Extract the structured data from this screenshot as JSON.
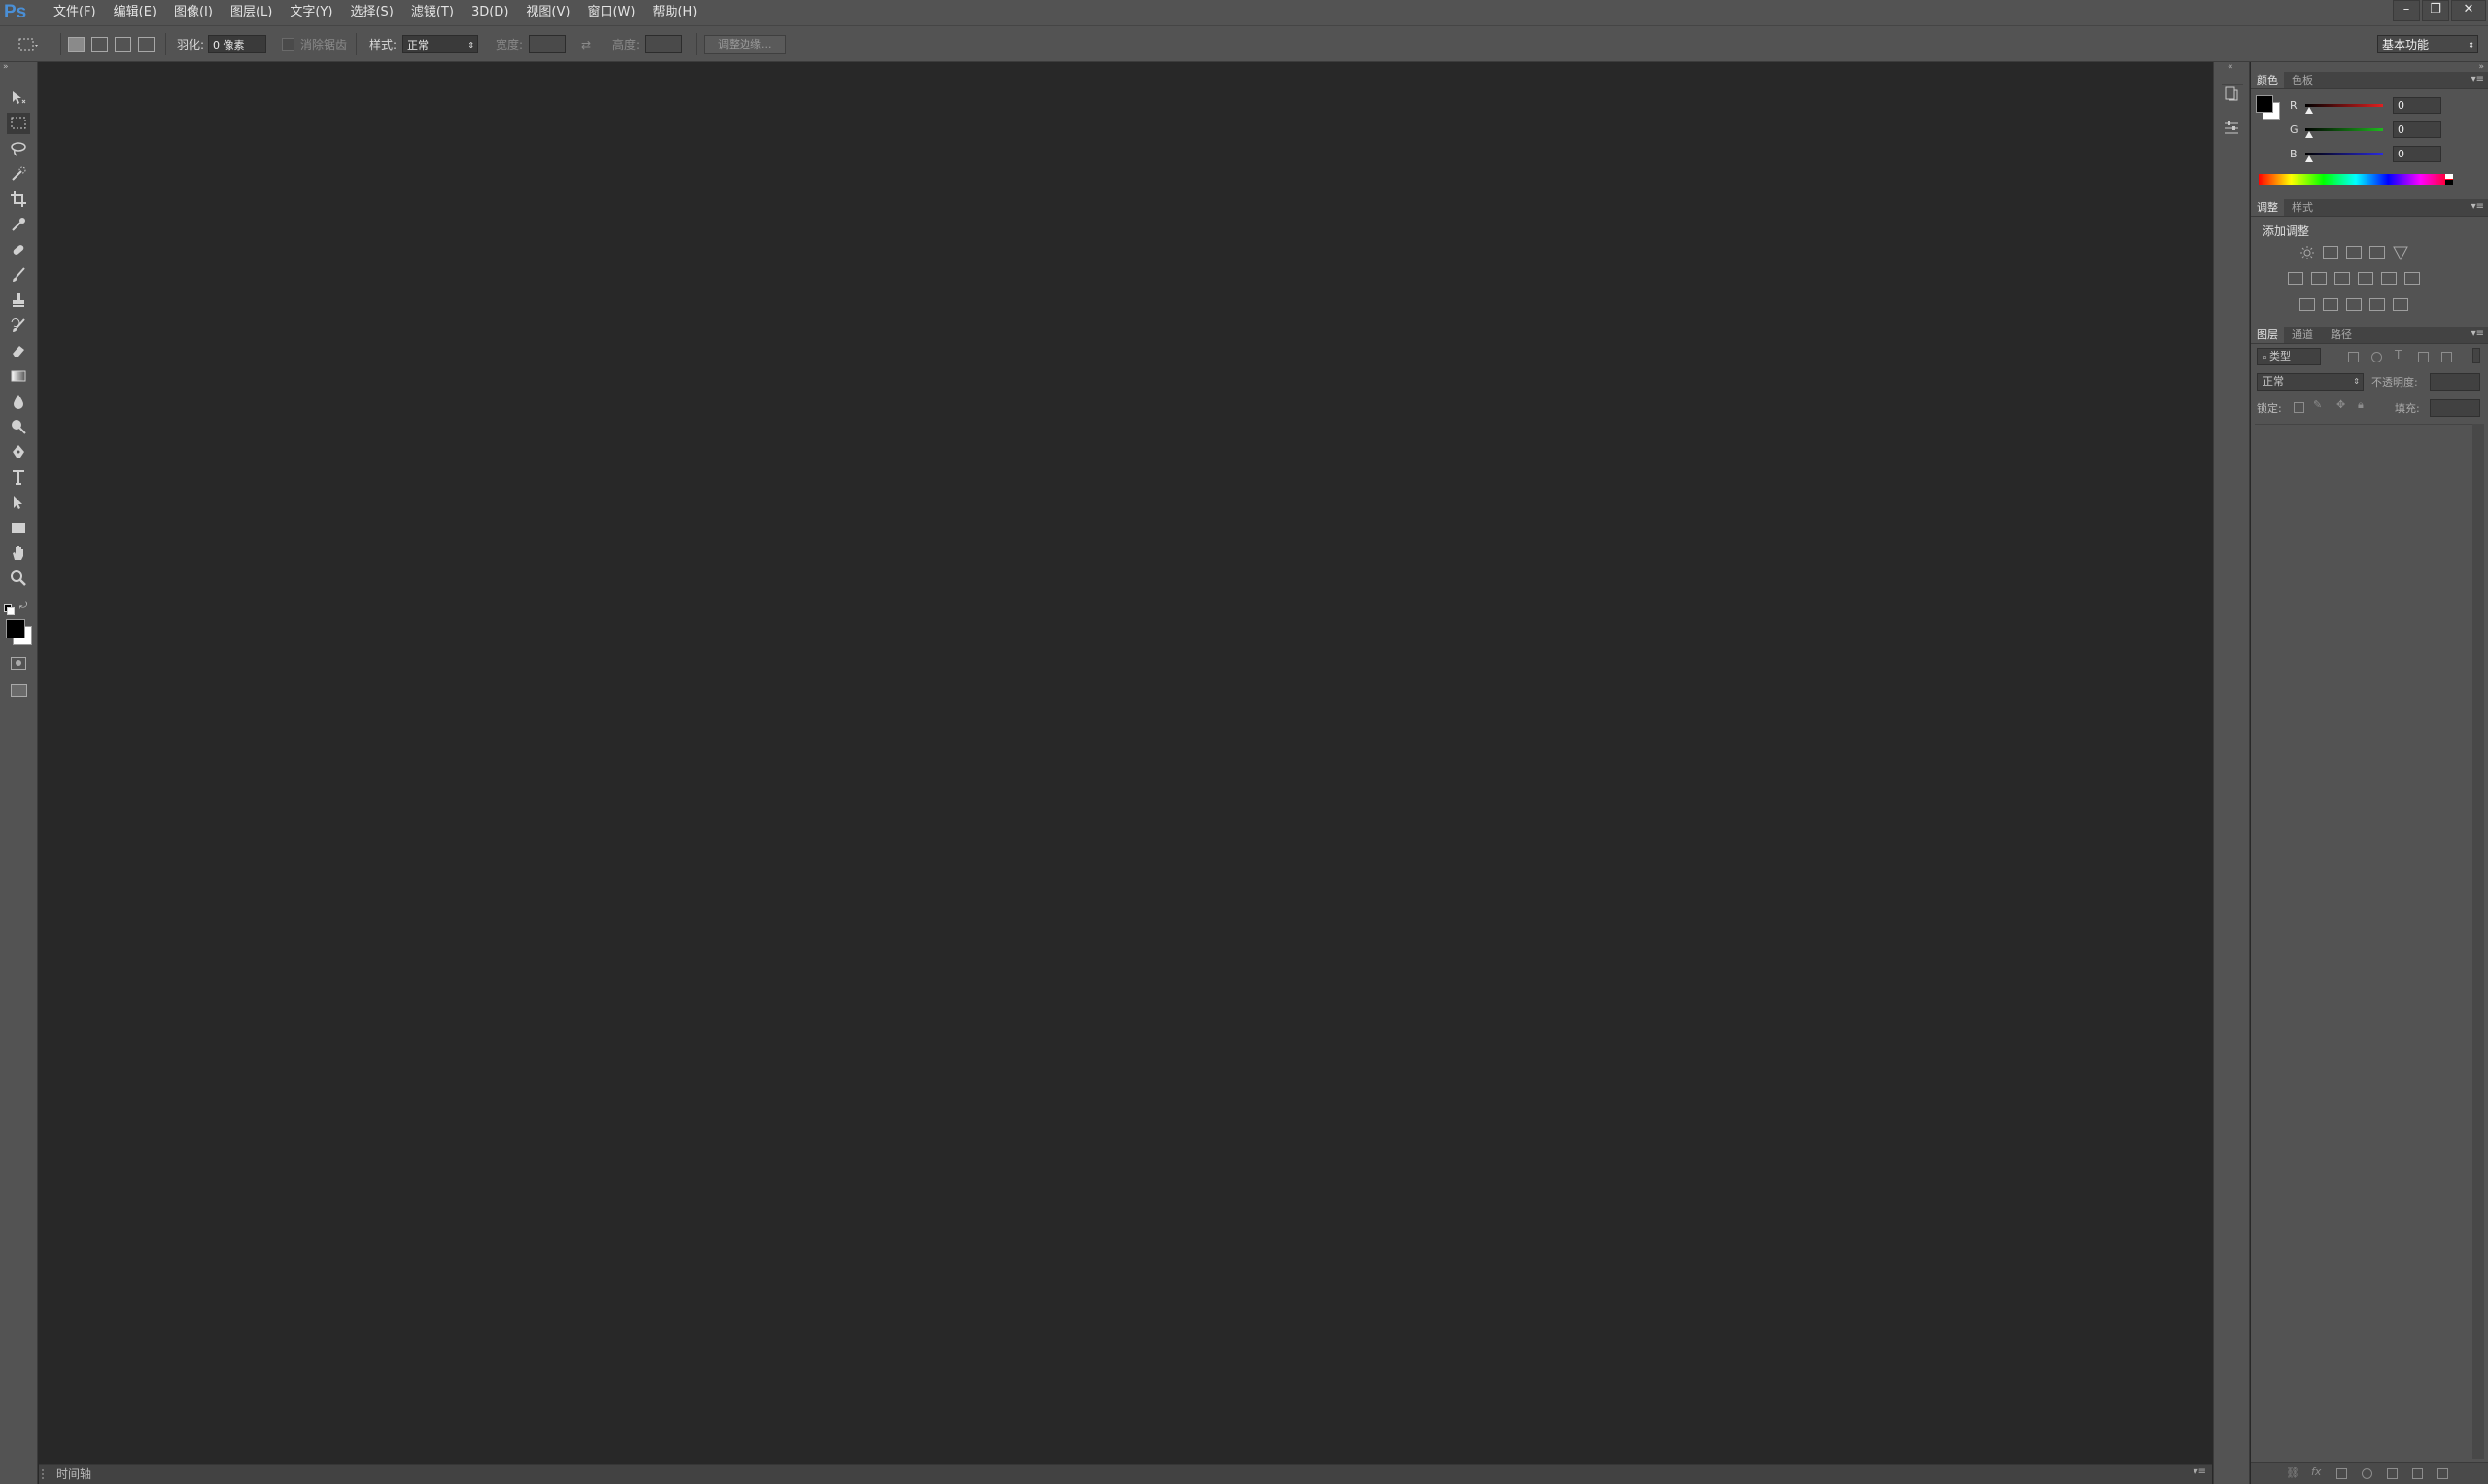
{
  "app": {
    "logo": "Ps"
  },
  "menu": [
    "文件(F)",
    "编辑(E)",
    "图像(I)",
    "图层(L)",
    "文字(Y)",
    "选择(S)",
    "滤镜(T)",
    "3D(D)",
    "视图(V)",
    "窗口(W)",
    "帮助(H)"
  ],
  "window_controls": {
    "minimize": "–",
    "restore": "❐",
    "close": "✕"
  },
  "options": {
    "feather_label": "羽化:",
    "feather_value": "0 像素",
    "antialias_label": "消除锯齿",
    "style_label": "样式:",
    "style_value": "正常",
    "width_label": "宽度:",
    "height_label": "高度:",
    "refine_edge_button": "调整边缘...",
    "workspace_value": "基本功能"
  },
  "tools": [
    "move-tool",
    "rectangular-marquee-tool",
    "lasso-tool",
    "quick-selection-tool",
    "crop-tool",
    "eyedropper-tool",
    "spot-healing-brush-tool",
    "brush-tool",
    "clone-stamp-tool",
    "history-brush-tool",
    "eraser-tool",
    "gradient-tool",
    "blur-tool",
    "dodge-tool",
    "pen-tool",
    "type-tool",
    "path-selection-tool",
    "rectangle-tool",
    "hand-tool",
    "zoom-tool"
  ],
  "colors": {
    "foreground": "#000000",
    "background": "#ffffff",
    "red": "#e02020",
    "green": "#1fb81f",
    "blue": "#2a2ae0"
  },
  "color_panel": {
    "tabs": [
      "颜色",
      "色板"
    ],
    "channels": [
      {
        "label": "R",
        "value": "0"
      },
      {
        "label": "G",
        "value": "0"
      },
      {
        "label": "B",
        "value": "0"
      }
    ]
  },
  "adjustments_panel": {
    "tabs": [
      "调整",
      "样式"
    ],
    "heading": "添加调整"
  },
  "layers_panel": {
    "tabs": [
      "图层",
      "通道",
      "路径"
    ],
    "filter_value": "类型",
    "blend_mode": "正常",
    "opacity_label": "不透明度:",
    "lock_label": "锁定:",
    "fill_label": "填充:"
  },
  "statusbar": {
    "timeline_label": "时间轴"
  }
}
